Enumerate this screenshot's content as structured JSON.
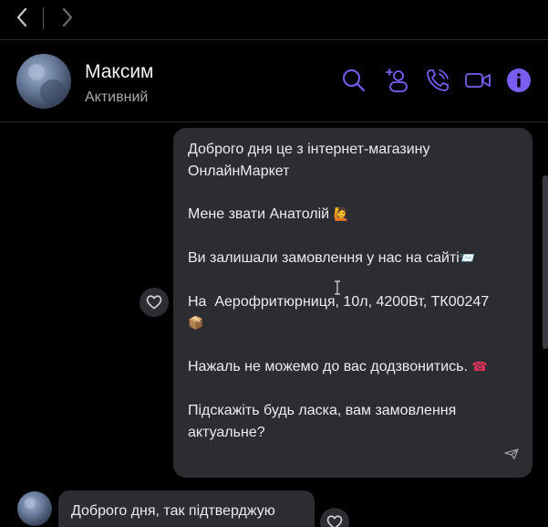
{
  "nav": {
    "back_icon": "chevron-left-icon",
    "forward_icon": "chevron-right-icon"
  },
  "header": {
    "contact_name": "Максим",
    "status": "Активний",
    "icons": [
      "search-icon",
      "add-user-icon",
      "voice-call-icon",
      "video-call-icon",
      "info-icon"
    ],
    "accent_color": "#7b5cf0"
  },
  "messages": {
    "outgoing": {
      "greeting": "Доброго дня це з інтернет-магазину ОнлайнМаркет",
      "intro": "Мене звати Анатолій",
      "intro_emoji": "🙋",
      "order_text": "Ви залишали замовлення у нас на сайті",
      "order_emoji": "📨",
      "product": "На  Аерофритюрниця, 10л, 4200Вт, ТК00247",
      "product_emoji": "📦",
      "no_answer": "Нажаль не можемо до вас додзвонитись.",
      "no_answer_emoji": "☎",
      "question": "Підскажіть будь ласка, вам замовлення актуальне?"
    },
    "incoming": {
      "text": "Доброго дня, так підтверджую"
    }
  },
  "colors": {
    "background": "#000000",
    "bubble": "#2c2c33",
    "text": "#ececf0",
    "muted": "#a6a6ad"
  }
}
